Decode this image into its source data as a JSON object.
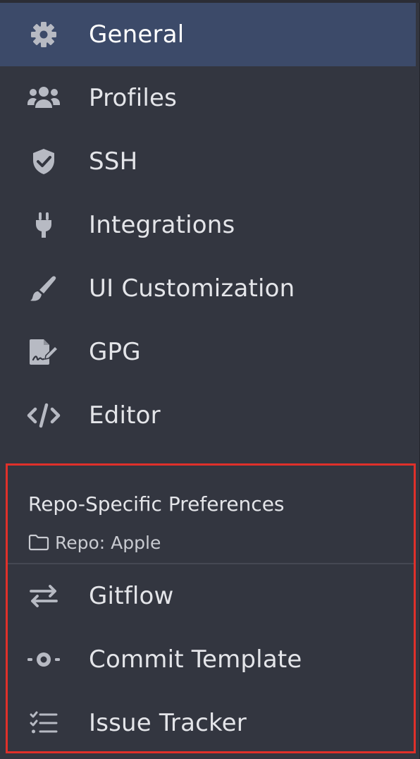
{
  "colors": {
    "background": "#333640",
    "active_background": "#3c4a69",
    "icon": "#b7bac3",
    "text": "#e4e5e9",
    "highlight_border": "#e0302a"
  },
  "nav": {
    "items": [
      {
        "label": "General",
        "icon": "gear-icon",
        "active": true
      },
      {
        "label": "Profiles",
        "icon": "users-icon"
      },
      {
        "label": "SSH",
        "icon": "shield-check-icon"
      },
      {
        "label": "Integrations",
        "icon": "plug-icon"
      },
      {
        "label": "UI Customization",
        "icon": "paintbrush-icon"
      },
      {
        "label": "GPG",
        "icon": "signed-document-icon"
      },
      {
        "label": "Editor",
        "icon": "code-icon"
      }
    ]
  },
  "repo": {
    "title": "Repo-Specific Preferences",
    "repo_label": "Repo: Apple",
    "items": [
      {
        "label": "Gitflow",
        "icon": "swap-arrows-icon"
      },
      {
        "label": "Commit Template",
        "icon": "commit-icon"
      },
      {
        "label": "Issue Tracker",
        "icon": "checklist-icon"
      }
    ]
  }
}
